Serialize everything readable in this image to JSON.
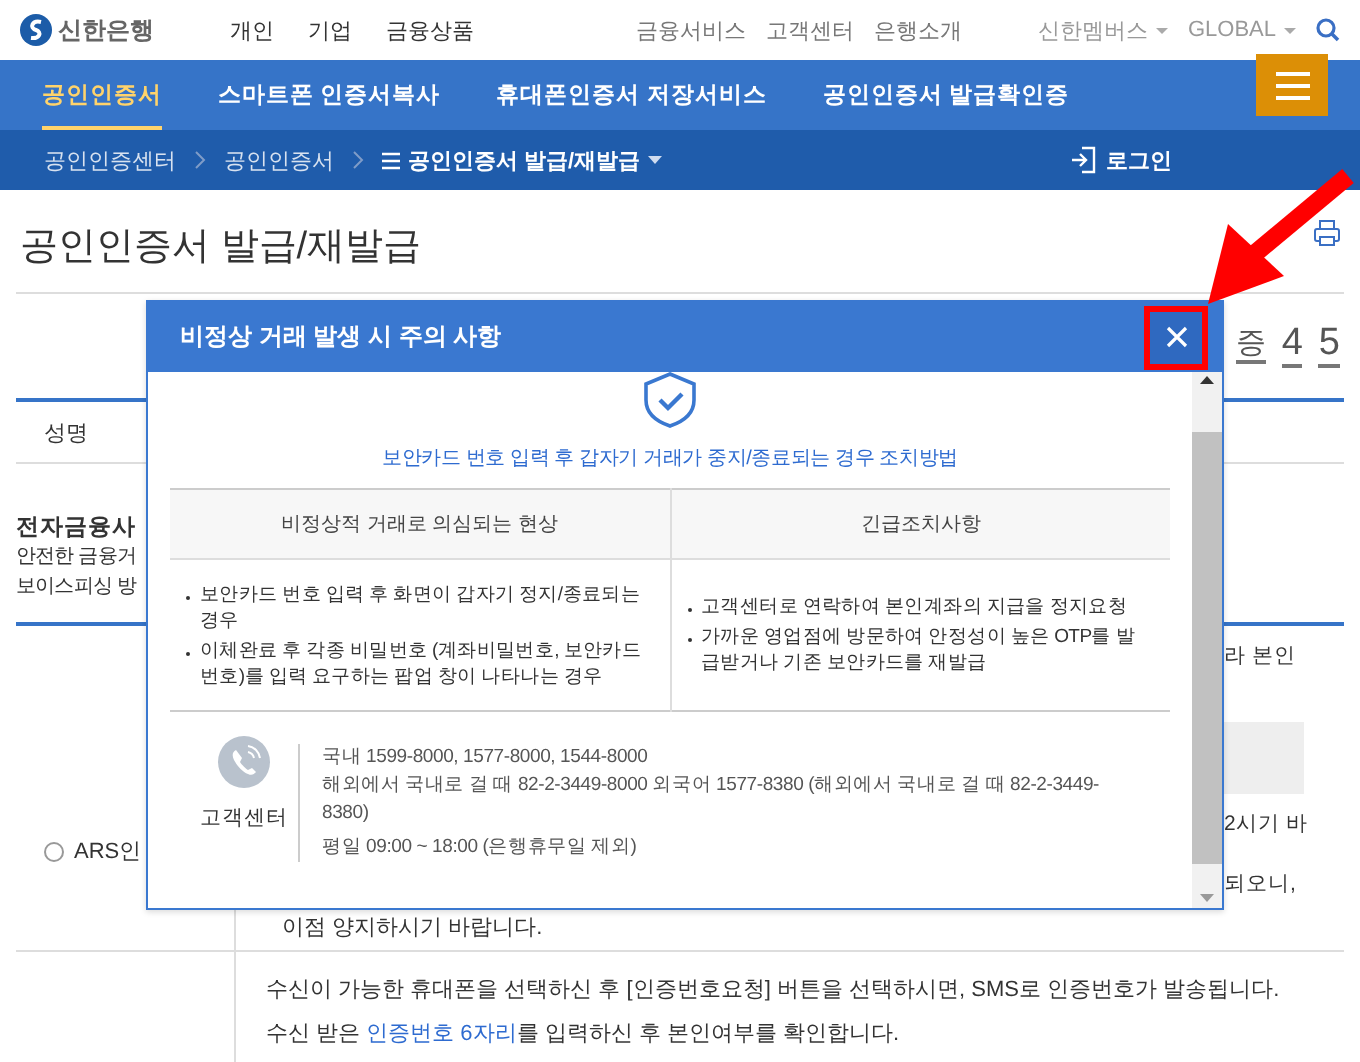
{
  "header": {
    "logo": "신한은행",
    "top_menu": [
      "개인",
      "기업",
      "금융상품"
    ],
    "util_menu": [
      "금융서비스",
      "고객센터",
      "은행소개"
    ],
    "dropdowns": [
      "신한멤버스",
      "GLOBAL"
    ]
  },
  "nav": {
    "tabs": [
      {
        "label": "공인인증서",
        "selected": true
      },
      {
        "label": "스마트폰 인증서복사",
        "selected": false
      },
      {
        "label": "휴대폰인증서 저장서비스",
        "selected": false
      },
      {
        "label": "공인인증서 발급확인증",
        "selected": false
      }
    ]
  },
  "breadcrumb": {
    "items": [
      "공인인증센터",
      "공인인증서",
      "공인인증서 발급/재발급"
    ],
    "login": "로그인"
  },
  "page": {
    "title": "공인인증서 발급/재발급",
    "steps": [
      "증",
      "4",
      "5"
    ],
    "name_label": "성명",
    "section_title": "전자금융사",
    "section_lines": [
      "안전한 금융거",
      "보이스피싱 방"
    ],
    "fragments_right": [
      "라 본인",
      "2시기 바",
      "되오니,"
    ],
    "ars": {
      "label": "ARS인",
      "selected": false
    },
    "note": "이점 양지하시기 바랍니다.",
    "sms_line": "수신이 가능한 휴대폰을 선택하신 후 [인증번호요청] 버튼을 선택하시면, SMS로 인증번호가 발송됩니다.",
    "sms_line2": {
      "before": "수신 받은 ",
      "link": "인증번호 6자리",
      "after": "를 입력하신 후 본인여부를 확인합니다."
    }
  },
  "modal": {
    "title": "비정상 거래 발생 시 주의 사항",
    "subtitle": "보안카드 번호 입력 후 갑자기 거래가 중지/종료되는 경우 조치방법",
    "table": {
      "columns": [
        "비정상적 거래로 의심되는 현상",
        "긴급조치사항"
      ],
      "cells": [
        [
          "보안카드 번호 입력 후 화면이 갑자기 정지/종료되는 경우",
          "이체완료 후 각종 비밀번호 (계좌비밀번호, 보안카드 번호)를 입력 요구하는 팝업 창이 나타나는 경우"
        ],
        [
          "고객센터로 연락하여 본인계좌의 지급을 정지요청",
          "가까운 영업점에 방문하여 안정성이 높은 OTP를 발급받거나 기존 보안카드를 재발급"
        ]
      ]
    },
    "contact": {
      "label": "고객센터",
      "lines": [
        "국내 1599-8000, 1577-8000, 1544-8000",
        "해외에서 국내로 걸 때 82-2-3449-8000   외국어 1577-8380 (해외에서 국내로 걸 때 82-2-3449-8380)",
        "평일 09:00 ~ 18:00 (은행휴무일 제외)"
      ]
    }
  }
}
